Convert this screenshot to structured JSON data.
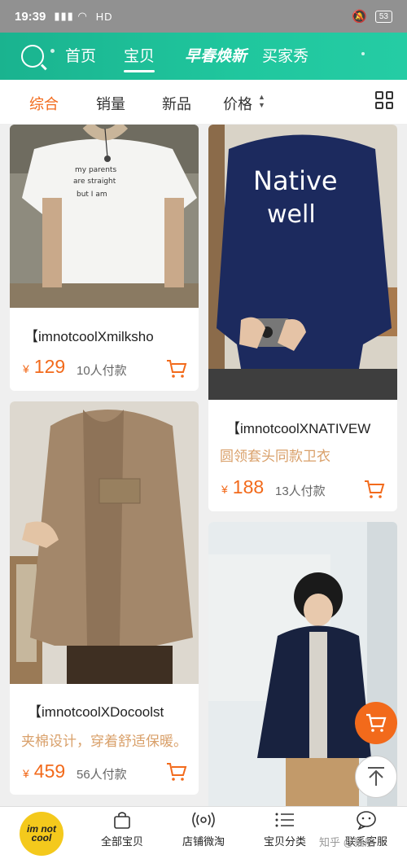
{
  "status": {
    "time": "19:39",
    "network": "HD",
    "battery": "53"
  },
  "topnav": {
    "tabs": [
      {
        "label": "首页"
      },
      {
        "label": "宝贝"
      },
      {
        "label": "早春焕新"
      },
      {
        "label": "买家秀"
      }
    ],
    "active_tab": "宝贝"
  },
  "sort": {
    "items": [
      {
        "label": "综合"
      },
      {
        "label": "销量"
      },
      {
        "label": "新品"
      },
      {
        "label": "价格"
      }
    ],
    "active": "综合"
  },
  "products": [
    {
      "title": "【imnotcoolXmilksho",
      "subtitle": "",
      "currency": "¥",
      "price": "129",
      "sold": "10人付款",
      "image": "white-tshirt-photo"
    },
    {
      "title": "【imnotcoolXNATIVEW",
      "subtitle": "圆领套头同款卫衣",
      "currency": "¥",
      "price": "188",
      "sold": "13人付款",
      "image": "navy-sweatshirt-photo",
      "print_text": "Native well"
    },
    {
      "title": "【imnotcoolXDocoolst",
      "subtitle": "夹棉设计，穿着舒适保暖。",
      "currency": "¥",
      "price": "459",
      "sold": "56人付款",
      "image": "tweed-jacket-photo"
    },
    {
      "title": "",
      "subtitle": "",
      "currency": "",
      "price": "",
      "sold": "",
      "image": "navy-jacket-photo"
    }
  ],
  "bottom": {
    "logo_text": "im not cool",
    "items": [
      {
        "label": "全部宝贝",
        "icon": "bag-icon"
      },
      {
        "label": "店铺微淘",
        "icon": "broadcast-icon"
      },
      {
        "label": "宝贝分类",
        "icon": "list-icon"
      },
      {
        "label": "联系客服",
        "icon": "chat-icon"
      }
    ]
  },
  "watermark": "知乎 @猫舶",
  "colors": {
    "accent": "#f26a1b",
    "header": "#1fbf98"
  }
}
